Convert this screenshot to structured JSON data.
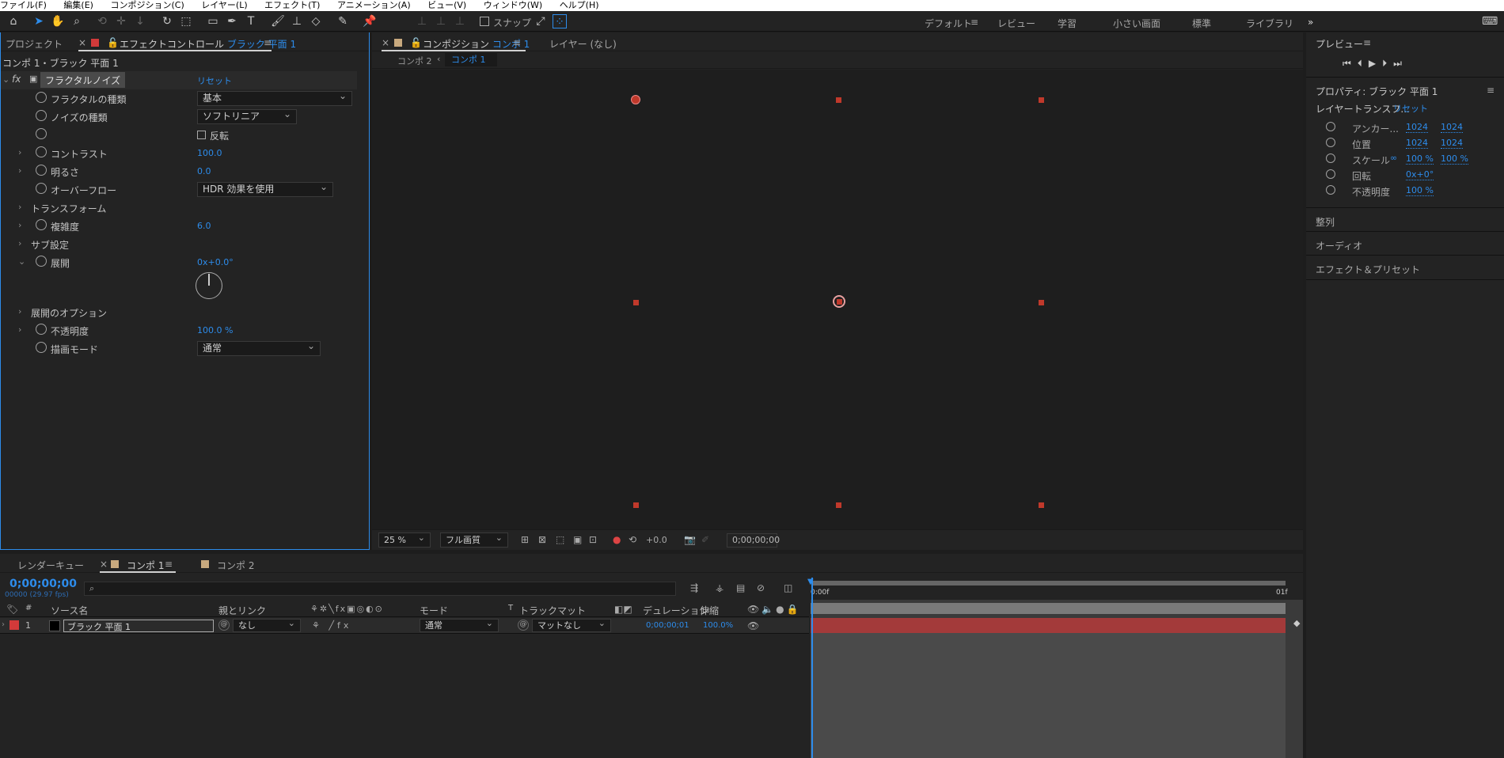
{
  "menu": [
    "ファイル(F)",
    "編集(E)",
    "コンポジション(C)",
    "レイヤー(L)",
    "エフェクト(T)",
    "アニメーション(A)",
    "ビュー(V)",
    "ウィンドウ(W)",
    "ヘルプ(H)"
  ],
  "toolbar": {
    "snap_label": "スナップ"
  },
  "workspaces": [
    "デフォルト",
    "レビュー",
    "学習",
    "小さい画面",
    "標準",
    "ライブラリ"
  ],
  "accent": "#2d8ceb",
  "effect_panel": {
    "tab_project": "プロジェクト",
    "tab_effect_prefix": "エフェクトコントロール",
    "tab_effect_layer": "ブラック 平面 1",
    "breadcrumb": "コンポ 1・ブラック 平面 1",
    "effect_name": "フラクタルノイズ",
    "reset": "リセット",
    "fractal_type_label": "フラクタルの種類",
    "fractal_type_value": "基本",
    "noise_type_label": "ノイズの種類",
    "noise_type_value": "ソフトリニア",
    "invert_label": "反転",
    "contrast_label": "コントラスト",
    "contrast_value": "100.0",
    "brightness_label": "明るさ",
    "brightness_value": "0.0",
    "overflow_label": "オーバーフロー",
    "overflow_value": "HDR 効果を使用",
    "transform_label": "トランスフォーム",
    "complexity_label": "複雑度",
    "complexity_value": "6.0",
    "sub_label": "サブ設定",
    "evolution_label": "展開",
    "evolution_value": "0x+0.0°",
    "evolution_options_label": "展開のオプション",
    "opacity_label": "不透明度",
    "opacity_value": "100.0 %",
    "blend_label": "描画モード",
    "blend_value": "通常"
  },
  "comp_panel": {
    "tab_prefix": "コンポジション",
    "tab_comp": "コンポ 1",
    "layer_tab": "レイヤー (なし)",
    "crumb_1": "コンポ 2",
    "crumb_2": "コンポ 1",
    "zoom": "25 %",
    "quality": "フル画質",
    "exposure": "+0.0",
    "timecode": "0;00;00;00"
  },
  "right_panel": {
    "preview": "プレビュー",
    "properties_title": "プロパティ: ブラック 平面 1",
    "layer_transform": "レイヤートランスフ...",
    "reset": "リセット",
    "anchor_label": "アンカー...",
    "anchor_x": "1024",
    "anchor_y": "1024",
    "position_label": "位置",
    "position_x": "1024",
    "position_y": "1024",
    "scale_label": "スケール",
    "scale_x": "100 %",
    "scale_y": "100 %",
    "rotation_label": "回転",
    "rotation_value": "0x+0°",
    "opacity_label": "不透明度",
    "opacity_value": "100 %",
    "align": "整列",
    "audio": "オーディオ",
    "effects_presets": "エフェクト＆プリセット"
  },
  "timeline": {
    "tab_render": "レンダーキュー",
    "tab_comp1": "コンポ 1",
    "tab_comp2": "コンポ 2",
    "timecode": "0;00;00;00",
    "frames": "00000 (29.97 fps)",
    "col_num": "#",
    "col_source": "ソース名",
    "col_parent": "親とリンク",
    "col_mode": "モード",
    "col_t": "T",
    "col_matte": "トラックマット",
    "col_duration": "デュレーション",
    "col_stretch": "伸縮",
    "ruler_start": "0:00f",
    "ruler_end": "01f",
    "layer": {
      "num": "1",
      "name": "ブラック 平面 1",
      "parent": "なし",
      "mode": "通常",
      "matte": "マットなし",
      "duration": "0;00;00;01",
      "stretch": "100.0%"
    }
  }
}
